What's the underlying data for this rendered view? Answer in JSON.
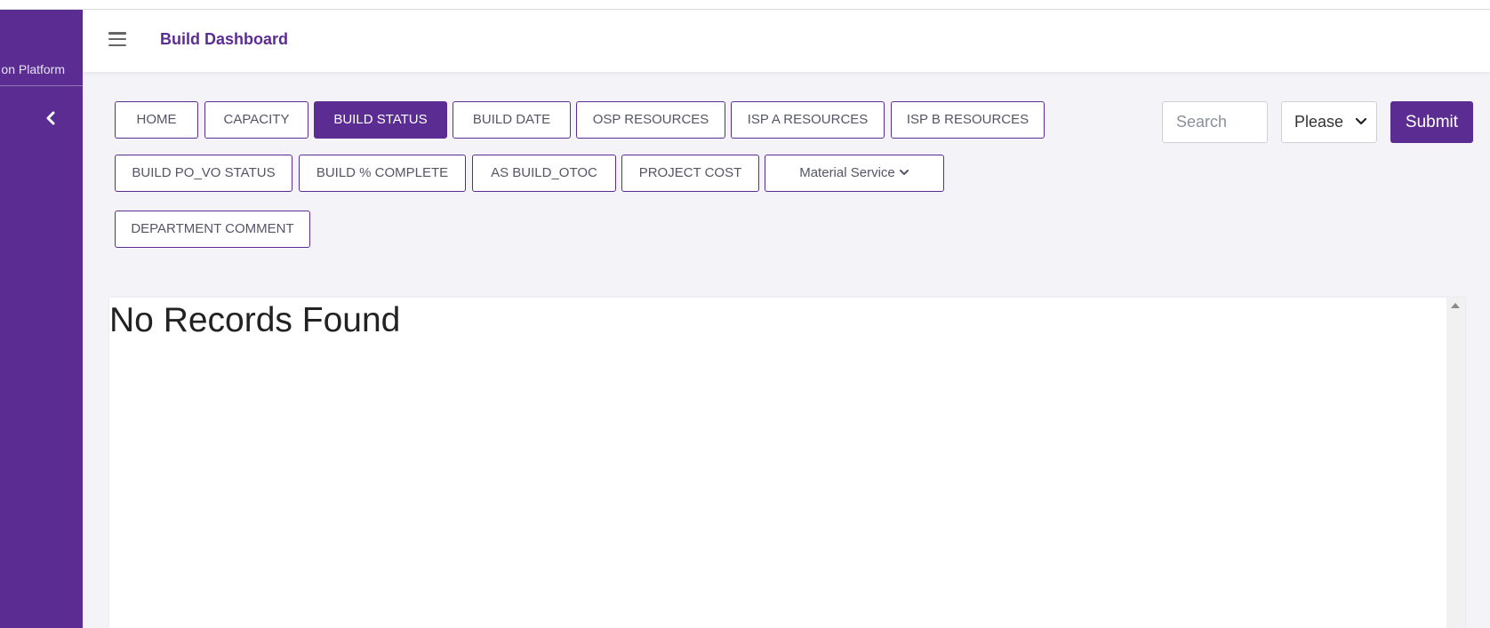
{
  "sidebar": {
    "brand": "on Platform",
    "collapse_icon": "chevron-left-icon"
  },
  "header": {
    "menu_icon": "hamburger-icon",
    "title": "Build Dashboard"
  },
  "nav": {
    "buttons": [
      {
        "label": "HOME",
        "active": false
      },
      {
        "label": "CAPACITY",
        "active": false
      },
      {
        "label": "BUILD STATUS",
        "active": true
      },
      {
        "label": "BUILD DATE",
        "active": false
      },
      {
        "label": "OSP RESOURCES",
        "active": false
      },
      {
        "label": "ISP A RESOURCES",
        "active": false
      },
      {
        "label": "ISP B RESOURCES",
        "active": false
      },
      {
        "label": "BUILD PO_VO STATUS",
        "active": false
      },
      {
        "label": "BUILD % COMPLETE",
        "active": false
      },
      {
        "label": "AS BUILD_OTOC",
        "active": false
      },
      {
        "label": "PROJECT COST",
        "active": false
      },
      {
        "label": "Material Service",
        "active": false,
        "dropdown": true
      },
      {
        "label": "DEPARTMENT COMMENT",
        "active": false
      }
    ]
  },
  "filters": {
    "search_placeholder": "Search",
    "search_value": "",
    "select_value": "Please",
    "submit_label": "Submit"
  },
  "results": {
    "empty_text": "No Records Found"
  },
  "colors": {
    "brand": "#5b2d93",
    "background": "#f4f4f8"
  }
}
